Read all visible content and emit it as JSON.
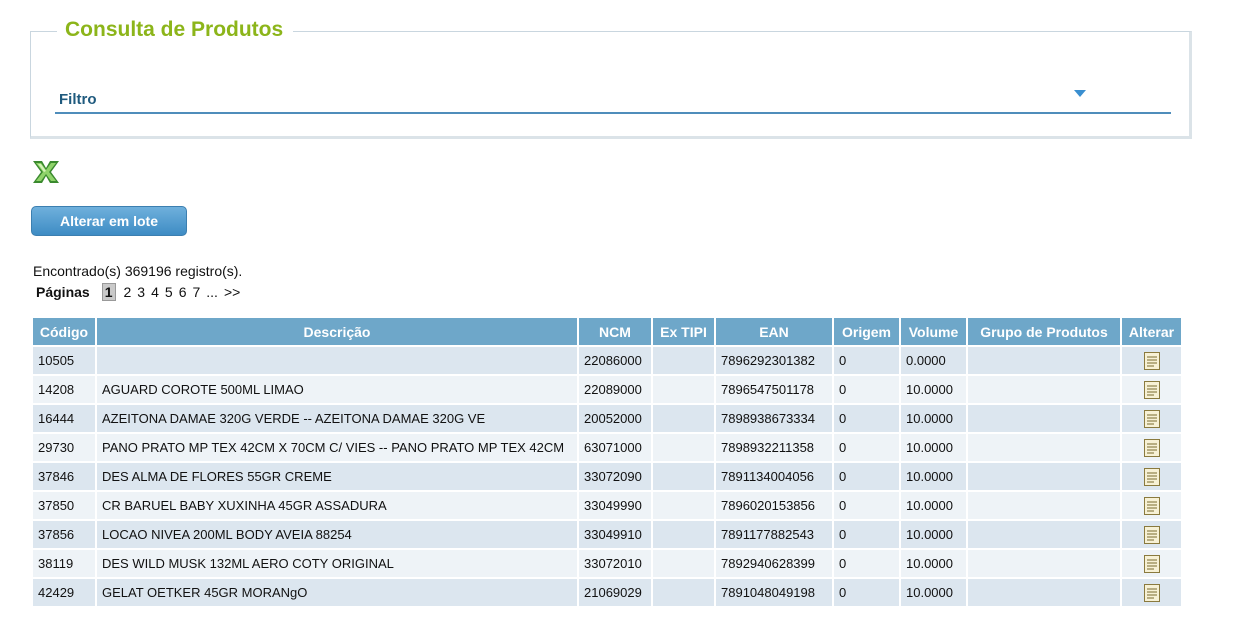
{
  "panel": {
    "title": "Consulta de Produtos",
    "filter_label": "Filtro"
  },
  "actions": {
    "excel_icon": "excel-export-icon",
    "batch_button": "Alterar em lote"
  },
  "results": {
    "found_text": "Encontrado(s) 369196 registro(s)."
  },
  "pager": {
    "label": "Páginas",
    "pages": [
      "1",
      "2",
      "3",
      "4",
      "5",
      "6",
      "7"
    ],
    "ellipsis": "...",
    "next": ">>"
  },
  "table": {
    "headers": [
      "Código",
      "Descrição",
      "NCM",
      "Ex TIPI",
      "EAN",
      "Origem",
      "Volume",
      "Grupo de Produtos",
      "Alterar"
    ],
    "rows": [
      {
        "codigo": "10505",
        "descricao": "",
        "ncm": "22086000",
        "ex_tipi": "",
        "ean": "7896292301382",
        "origem": "0",
        "volume": "0.0000",
        "grupo": ""
      },
      {
        "codigo": "14208",
        "descricao": "AGUARD COROTE 500ML LIMAO",
        "ncm": "22089000",
        "ex_tipi": "",
        "ean": "7896547501178",
        "origem": "0",
        "volume": "10.0000",
        "grupo": ""
      },
      {
        "codigo": "16444",
        "descricao": "AZEITONA DAMAE 320G VERDE -- AZEITONA DAMAE 320G VE",
        "ncm": "20052000",
        "ex_tipi": "",
        "ean": "7898938673334",
        "origem": "0",
        "volume": "10.0000",
        "grupo": ""
      },
      {
        "codigo": "29730",
        "descricao": "PANO PRATO MP TEX 42CM X 70CM C/ VIES -- PANO PRATO MP TEX 42CM",
        "ncm": "63071000",
        "ex_tipi": "",
        "ean": "7898932211358",
        "origem": "0",
        "volume": "10.0000",
        "grupo": ""
      },
      {
        "codigo": "37846",
        "descricao": "DES ALMA DE FLORES 55GR CREME",
        "ncm": "33072090",
        "ex_tipi": "",
        "ean": "7891134004056",
        "origem": "0",
        "volume": "10.0000",
        "grupo": ""
      },
      {
        "codigo": "37850",
        "descricao": "CR BARUEL BABY XUXINHA 45GR ASSADURA",
        "ncm": "33049990",
        "ex_tipi": "",
        "ean": "7896020153856",
        "origem": "0",
        "volume": "10.0000",
        "grupo": ""
      },
      {
        "codigo": "37856",
        "descricao": "LOCAO NIVEA 200ML BODY AVEIA 88254",
        "ncm": "33049910",
        "ex_tipi": "",
        "ean": "7891177882543",
        "origem": "0",
        "volume": "10.0000",
        "grupo": ""
      },
      {
        "codigo": "38119",
        "descricao": "DES WILD MUSK 132ML AERO COTY ORIGINAL",
        "ncm": "33072010",
        "ex_tipi": "",
        "ean": "7892940628399",
        "origem": "0",
        "volume": "10.0000",
        "grupo": ""
      },
      {
        "codigo": "42429",
        "descricao": "GELAT OETKER 45GR MORANgO",
        "ncm": "21069029",
        "ex_tipi": "",
        "ean": "7891048049198",
        "origem": "0",
        "volume": "10.0000",
        "grupo": ""
      }
    ],
    "edit_icon": "edit-document-icon"
  },
  "colors": {
    "title_green": "#8cb51a",
    "header_blue": "#6ea7c9",
    "row_odd": "#dce6ef",
    "row_even": "#eef3f7",
    "button_blue": "#3e8cc4"
  }
}
